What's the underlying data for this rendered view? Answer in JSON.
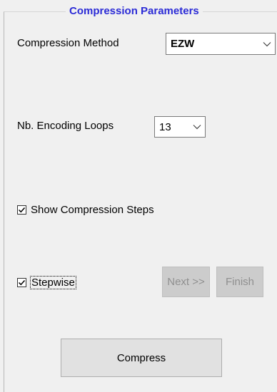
{
  "group": {
    "title": "Compression Parameters"
  },
  "compression_method": {
    "label": "Compression Method",
    "selected": "EZW"
  },
  "encoding_loops": {
    "label": "Nb. Encoding Loops",
    "selected": "13"
  },
  "show_steps": {
    "label": "Show Compression Steps",
    "checked": true
  },
  "stepwise": {
    "label": "Stepwise",
    "checked": true
  },
  "buttons": {
    "next_label": "Next >>",
    "finish_label": "Finish",
    "compress_label": "Compress"
  },
  "colors": {
    "group_title": "#2b2bd6",
    "panel_background": "#f0f0f0",
    "disabled_button": "#cccccc"
  },
  "icons": {
    "combo_arrow": "chevron-down-icon",
    "check_mark": "checkmark-icon"
  }
}
